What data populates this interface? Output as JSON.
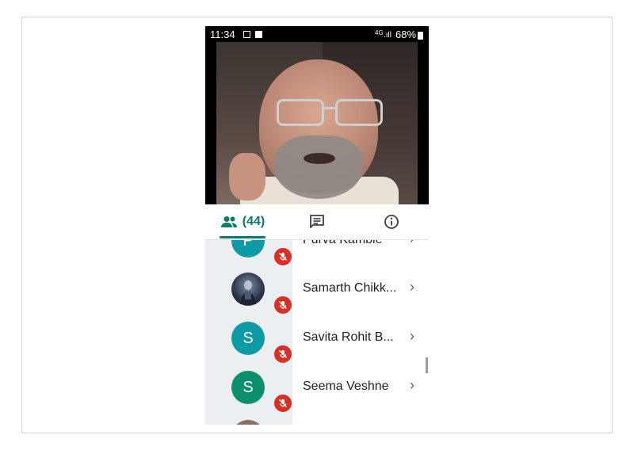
{
  "status": {
    "time": "11:34",
    "network": "4G",
    "battery": "68%"
  },
  "tabs": {
    "people_count": "(44)"
  },
  "participants": [
    {
      "initial": "P",
      "name": "Purva Kamble",
      "color": "#0b9aa6"
    },
    {
      "initial": "",
      "name": "Samarth Chikk...",
      "color": "#2d3a4d"
    },
    {
      "initial": "S",
      "name": "Savita Rohit B...",
      "color": "#0b9aa6"
    },
    {
      "initial": "S",
      "name": "Seema Veshne",
      "color": "#0b8f6e"
    },
    {
      "initial": "",
      "name": "",
      "color": "#8d6e63"
    }
  ],
  "icons": {
    "people": "people-icon",
    "chat": "chat-icon",
    "info": "info-icon",
    "mic_off": "mic-off-icon",
    "chevron": "chevron-right-icon"
  }
}
